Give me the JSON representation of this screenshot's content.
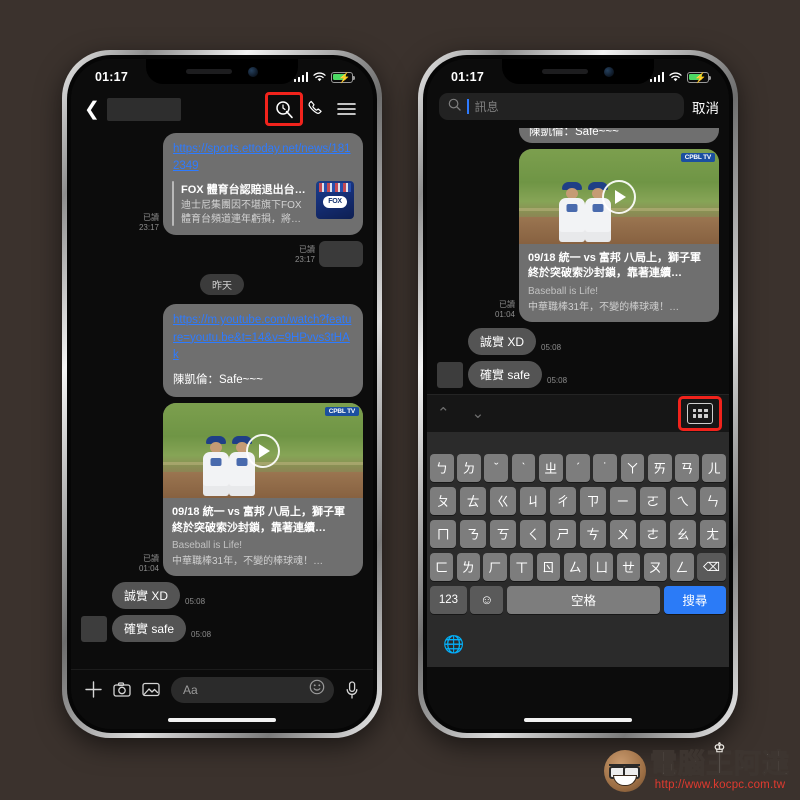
{
  "canvas": {
    "background_color": "#3b322d"
  },
  "watermark": {
    "brand": "電腦王阿達",
    "url": "http://www.kocpc.com.tw",
    "crown": "♔",
    "url_color": "#e03a2f"
  },
  "left_phone": {
    "status_bar": {
      "time": "01:17",
      "battery_state": "charging",
      "battery_color": "#4cd964"
    },
    "header": {
      "back_icon": "chevron-left",
      "contact_name_redacted": "",
      "search_icon": "search-icon",
      "call_icon": "phone-icon",
      "menu_icon": "hamburger-icon",
      "highlight_color": "#f1231c"
    },
    "messages": [
      {
        "type": "link_card_outgoing",
        "url": "https://sports.ettoday.net/news/1812349",
        "preview_title": "FOX 體育台認賠退出台…",
        "preview_desc": "迪士尼集團因不堪旗下FOX 體育台頻道連年虧損，將…",
        "thumb_label": "FOX",
        "read_status": "已讀",
        "time": "23:17"
      },
      {
        "type": "redacted_outgoing",
        "read_status": "已讀",
        "time": "23:17"
      },
      {
        "type": "day_divider",
        "label": "昨天"
      },
      {
        "type": "text_outgoing",
        "url": "https://m.youtube.com/watch?feature=youtu.be&t=14&v=9HPvvs3tHAk",
        "text": "陳凱倫：Safe~~~"
      },
      {
        "type": "video_card_outgoing",
        "title": "09/18 統一 vs 富邦 八局上，獅子軍終於突破索沙封鎖，靠著連續…",
        "subtitle1": "Baseball is Life!",
        "subtitle2": "中華職棒31年，不變的棒球魂！…",
        "channel_badge": "CPBL TV",
        "read_status": "已讀",
        "time": "01:04"
      },
      {
        "type": "text_incoming",
        "text": "誠實 XD",
        "time": "05:08"
      },
      {
        "type": "text_incoming",
        "text": "確實 safe",
        "time": "05:08"
      }
    ],
    "input_bar": {
      "plus_icon": "plus-icon",
      "camera_icon": "camera-icon",
      "gallery_icon": "image-icon",
      "placeholder": "Aa",
      "emoji_icon": "smiley-icon",
      "mic_icon": "microphone-icon"
    }
  },
  "right_phone": {
    "status_bar": {
      "time": "01:17",
      "battery_state": "charging",
      "battery_color": "#4cd964"
    },
    "search": {
      "icon": "search-icon",
      "placeholder": "訊息",
      "value": "",
      "cancel_label": "取消",
      "caret_color": "#2e7bff"
    },
    "partial_message": "陳凱倫：Safe~~~",
    "messages": [
      {
        "type": "video_card_outgoing",
        "title": "09/18 統一 vs 富邦 八局上，獅子軍終於突破索沙封鎖，靠著連續…",
        "subtitle1": "Baseball is Life!",
        "subtitle2": "中華職棒31年，不變的棒球魂！…",
        "channel_badge": "CPBL TV",
        "read_status": "已讀",
        "time": "01:04"
      },
      {
        "type": "text_incoming",
        "text": "誠實 XD",
        "time": "05:08"
      },
      {
        "type": "text_incoming",
        "text": "確實 safe",
        "time": "05:08"
      }
    ],
    "nav_strip": {
      "prev_icon": "chevron-up-icon",
      "next_icon": "chevron-down-icon",
      "keyboard_toggle_icon": "keyboard-grid-icon",
      "highlight_color": "#f1231c"
    },
    "keyboard": {
      "type": "zhuyin",
      "row1": [
        "ㄅ",
        "ㄉ",
        "ˇ",
        "ˋ",
        "ㄓ",
        "ˊ",
        "˙",
        "ㄚ",
        "ㄞ",
        "ㄢ",
        "ㄦ"
      ],
      "row2": [
        "ㄆ",
        "ㄊ",
        "ㄍ",
        "ㄐ",
        "ㄔ",
        "ㄗ",
        "ㄧ",
        "ㄛ",
        "ㄟ",
        "ㄣ"
      ],
      "row3": [
        "ㄇ",
        "ㄋ",
        "ㄎ",
        "ㄑ",
        "ㄕ",
        "ㄘ",
        "ㄨ",
        "ㄜ",
        "ㄠ",
        "ㄤ"
      ],
      "row4": [
        "ㄈ",
        "ㄌ",
        "ㄏ",
        "ㄒ",
        "ㄖ",
        "ㄙ",
        "ㄩ",
        "ㄝ",
        "ㄡ",
        "ㄥ"
      ],
      "backspace_icon": "backspace-icon",
      "num_key": "123",
      "emoji_key": "smiley-icon",
      "space_key": "空格",
      "search_key": "搜尋",
      "search_key_color": "#2b7bf7",
      "globe_icon": "globe-icon"
    }
  }
}
